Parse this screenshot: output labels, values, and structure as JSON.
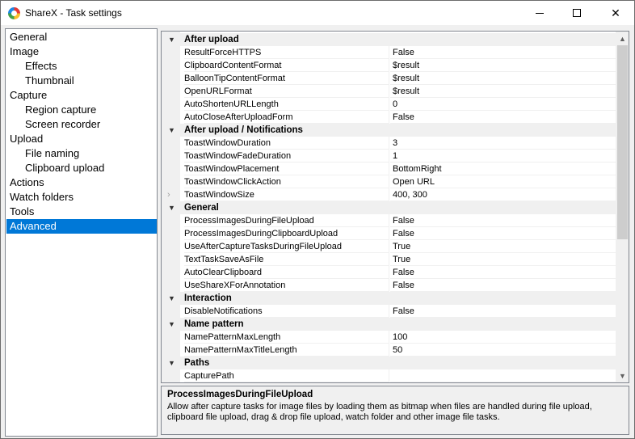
{
  "window": {
    "title": "ShareX - Task settings"
  },
  "nav": {
    "items": [
      {
        "label": "General",
        "level": 0,
        "selected": false
      },
      {
        "label": "Image",
        "level": 0,
        "selected": false
      },
      {
        "label": "Effects",
        "level": 1,
        "selected": false
      },
      {
        "label": "Thumbnail",
        "level": 1,
        "selected": false
      },
      {
        "label": "Capture",
        "level": 0,
        "selected": false
      },
      {
        "label": "Region capture",
        "level": 1,
        "selected": false
      },
      {
        "label": "Screen recorder",
        "level": 1,
        "selected": false
      },
      {
        "label": "Upload",
        "level": 0,
        "selected": false
      },
      {
        "label": "File naming",
        "level": 1,
        "selected": false
      },
      {
        "label": "Clipboard upload",
        "level": 1,
        "selected": false
      },
      {
        "label": "Actions",
        "level": 0,
        "selected": false
      },
      {
        "label": "Watch folders",
        "level": 0,
        "selected": false
      },
      {
        "label": "Tools",
        "level": 0,
        "selected": false
      },
      {
        "label": "Advanced",
        "level": 0,
        "selected": true
      }
    ]
  },
  "grid": {
    "rows": [
      {
        "type": "category",
        "label": "After upload"
      },
      {
        "type": "property",
        "name": "ResultForceHTTPS",
        "value": "False"
      },
      {
        "type": "property",
        "name": "ClipboardContentFormat",
        "value": "$result"
      },
      {
        "type": "property",
        "name": "BalloonTipContentFormat",
        "value": "$result"
      },
      {
        "type": "property",
        "name": "OpenURLFormat",
        "value": "$result"
      },
      {
        "type": "property",
        "name": "AutoShortenURLLength",
        "value": "0"
      },
      {
        "type": "property",
        "name": "AutoCloseAfterUploadForm",
        "value": "False"
      },
      {
        "type": "category",
        "label": "After upload / Notifications"
      },
      {
        "type": "property",
        "name": "ToastWindowDuration",
        "value": "3"
      },
      {
        "type": "property",
        "name": "ToastWindowFadeDuration",
        "value": "1"
      },
      {
        "type": "property",
        "name": "ToastWindowPlacement",
        "value": "BottomRight"
      },
      {
        "type": "property",
        "name": "ToastWindowClickAction",
        "value": "Open URL"
      },
      {
        "type": "property",
        "name": "ToastWindowSize",
        "value": "400, 300",
        "expandable": true
      },
      {
        "type": "category",
        "label": "General"
      },
      {
        "type": "property",
        "name": "ProcessImagesDuringFileUpload",
        "value": "False"
      },
      {
        "type": "property",
        "name": "ProcessImagesDuringClipboardUpload",
        "value": "False"
      },
      {
        "type": "property",
        "name": "UseAfterCaptureTasksDuringFileUpload",
        "value": "True"
      },
      {
        "type": "property",
        "name": "TextTaskSaveAsFile",
        "value": "True"
      },
      {
        "type": "property",
        "name": "AutoClearClipboard",
        "value": "False"
      },
      {
        "type": "property",
        "name": "UseShareXForAnnotation",
        "value": "False"
      },
      {
        "type": "category",
        "label": "Interaction"
      },
      {
        "type": "property",
        "name": "DisableNotifications",
        "value": "False"
      },
      {
        "type": "category",
        "label": "Name pattern"
      },
      {
        "type": "property",
        "name": "NamePatternMaxLength",
        "value": "100"
      },
      {
        "type": "property",
        "name": "NamePatternMaxTitleLength",
        "value": "50"
      },
      {
        "type": "category",
        "label": "Paths"
      },
      {
        "type": "property",
        "name": "CapturePath",
        "value": ""
      }
    ],
    "toggle_glyph": "▼",
    "expand_glyph": "›"
  },
  "scrollbar": {
    "up_glyph": "▲",
    "down_glyph": "▼"
  },
  "description": {
    "title": "ProcessImagesDuringFileUpload",
    "body": "Allow after capture tasks for image files by loading them as bitmap when files are handled during file upload, clipboard file upload, drag & drop file upload, watch folder and other image file tasks."
  }
}
